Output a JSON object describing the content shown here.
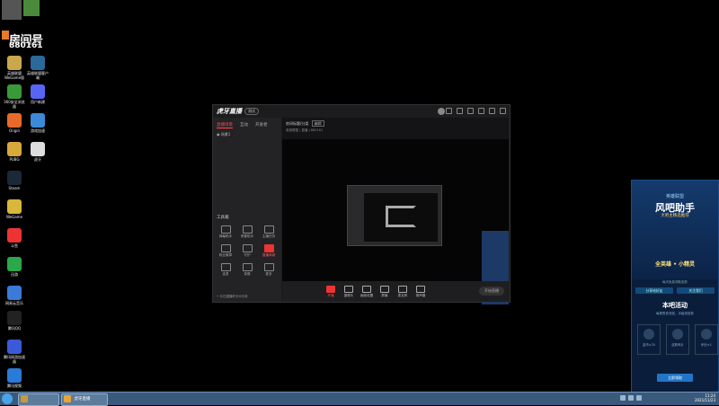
{
  "overlay": {
    "room_label": "房间号",
    "room_number": "880161"
  },
  "desktop_icons": [
    {
      "label": "英雄联盟WeGame版",
      "icon": "lol-icon",
      "color": "#c8a84b"
    },
    {
      "label": "英雄联盟客户端",
      "icon": "lol-client-icon",
      "color": "#2a6a9a"
    },
    {
      "label": "360安全浏览器",
      "icon": "browser-icon",
      "color": "#3a9a3a"
    },
    {
      "label": "用户新建",
      "icon": "discord-like-icon",
      "color": "#5865f2"
    },
    {
      "label": "Origin",
      "icon": "origin-icon",
      "color": "#e86a2a"
    },
    {
      "label": "游戏加速",
      "icon": "accelerator-icon",
      "color": "#3a8ad8"
    },
    {
      "label": "PUBG",
      "icon": "pubg-icon",
      "color": "#d8a83a"
    },
    {
      "label": "虎牙",
      "icon": "anime-icon",
      "color": "#ddd"
    },
    {
      "label": "Steam",
      "icon": "steam-icon",
      "color": "#1b2838"
    },
    {
      "label": "WeGame",
      "icon": "wegame-icon",
      "color": "#d8b83a"
    },
    {
      "label": "斗鱼",
      "icon": "douyu-icon",
      "color": "#e33"
    },
    {
      "label": "迅游",
      "icon": "lock-green-icon",
      "color": "#2aa84a"
    },
    {
      "label": "网易云音乐",
      "icon": "netease-icon",
      "color": "#3a7ad8"
    },
    {
      "label": "腾讯QQ",
      "icon": "qq-icon",
      "color": "#222"
    },
    {
      "label": "腾讯网游加速器",
      "icon": "tencent-acc-icon",
      "color": "#3a5ad8"
    },
    {
      "label": "腾讯视频",
      "icon": "video-icon",
      "color": "#2a7ad8"
    }
  ],
  "app": {
    "logo": "虎牙直播",
    "version_badge": "测试",
    "tabs": [
      "直播场景",
      "互动",
      "开发者"
    ],
    "scene_row": "场景1",
    "room_info": "房间标题/分类",
    "room_badge": "编辑",
    "room_sub": "英雄联盟 | 直播 | 880161",
    "toolbox_title": "工具箱",
    "tools": [
      {
        "label": "弹幕助手",
        "red": false
      },
      {
        "label": "房管助手",
        "red": false
      },
      {
        "label": "主播任务",
        "red": false
      },
      {
        "label": "粉丝徽章",
        "red": false
      },
      {
        "label": "守护",
        "red": false
      },
      {
        "label": "直播商城",
        "red": true
      },
      {
        "label": "连麦",
        "red": false
      },
      {
        "label": "录像",
        "red": false
      },
      {
        "label": "更多",
        "red": false
      }
    ],
    "bottom_tip": "• 今日直播时长0分钟",
    "controls": [
      "开播",
      "摄像头",
      "画面设置",
      "屏幕",
      "麦克风",
      "扬声器"
    ],
    "start_label": "开始直播"
  },
  "ad_panel": {
    "small_brand": "英雄联盟",
    "brand": "风吧助手",
    "tag": "大吧主精选推荐",
    "promo": "全英雄 • 小精灵",
    "line": "每天免费领取皮肤",
    "btn_left": "分享给好友",
    "btn_right": "关注我们",
    "activity_title": "本吧活动",
    "activity_desc": "每周签到领奖，冲级领皮肤",
    "items": [
      "金币×20",
      "皮肤碎片",
      "积分×1"
    ],
    "claim": "立即领取"
  },
  "taskbar": {
    "items": [
      {
        "label": "",
        "color": "#c89a3a"
      },
      {
        "label": "虎牙直播",
        "color": "#e8a43a"
      }
    ],
    "time": "11:24",
    "date": "2021/11/23"
  }
}
